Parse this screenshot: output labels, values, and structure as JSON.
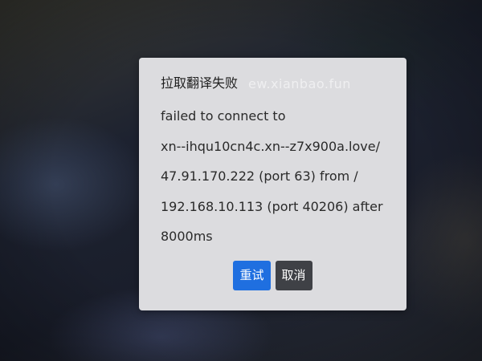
{
  "dialog": {
    "title": "拉取翻译失败",
    "watermark": "ew.xianbao.fun",
    "message_lines": [
      "failed to connect to",
      "xn--ihqu10cn4c.xn--z7x900a.love/",
      "47.91.170.222 (port 63) from /",
      "192.168.10.113 (port 40206) after",
      "8000ms"
    ],
    "retry_label": "重试",
    "cancel_label": "取消"
  },
  "colors": {
    "retry_button": "#1f6fe0",
    "cancel_button": "#3f4146",
    "dialog_background": "#dcdcdf"
  }
}
